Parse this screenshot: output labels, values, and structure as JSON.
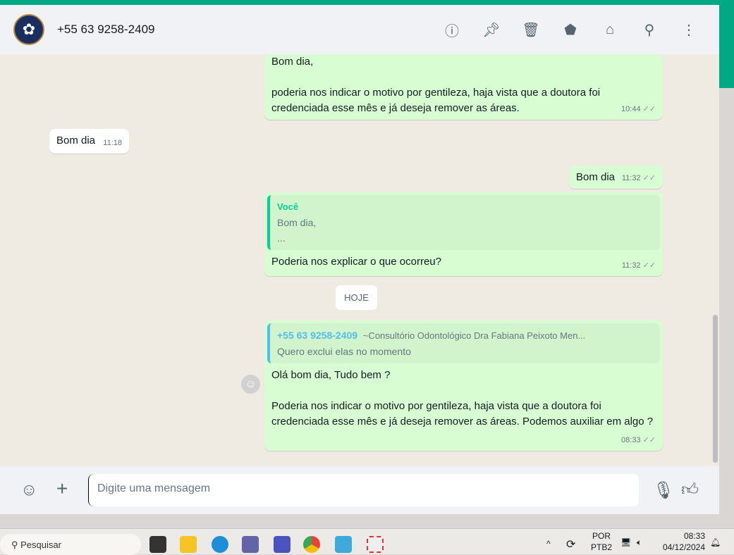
{
  "header": {
    "contact": "+55 63 9258-2409",
    "icons": [
      "info-icon",
      "pin-icon",
      "delete-icon",
      "label-icon",
      "store-icon",
      "search-icon",
      "menu-icon"
    ]
  },
  "messages": [
    {
      "dir": "out",
      "lines": [
        "Bom dia,",
        "",
        "poderia nos indicar o motivo por gentileza, haja vista que a doutora foi",
        "credenciada esse mês e já deseja remover as áreas."
      ],
      "time": "10:44"
    },
    {
      "dir": "in",
      "text": "Bom dia",
      "time": "11:18"
    },
    {
      "dir": "out",
      "text": "Bom dia",
      "time": "11:32"
    },
    {
      "dir": "out",
      "quote": {
        "author": "Você",
        "lines": [
          "Bom dia,",
          "..."
        ]
      },
      "text": "Poderia nos explicar o que ocorreu?",
      "time": "11:32"
    },
    {
      "dir": "out",
      "quote": {
        "author": "+55 63 9258-2409",
        "pushname": "~Consultório Odontológico Dra Fabiana Peixoto Men...",
        "text": "Quero exclui elas no momento"
      },
      "lines": [
        "Olá bom dia, Tudo bem ?",
        "",
        "Poderia nos indicar o motivo por gentileza, haja vista que a doutora foi",
        "credenciada esse mês e já deseja remover as áreas. Podemos auxiliar em algo ?"
      ],
      "time": "08:33"
    }
  ],
  "date_divider": "HOJE",
  "composer": {
    "placeholder": "Digite uma mensagem"
  },
  "taskbar": {
    "search": "Pesquisar",
    "lang1": "POR",
    "lang2": "PTB2",
    "time": "08:33",
    "date": "04/12/2024"
  }
}
